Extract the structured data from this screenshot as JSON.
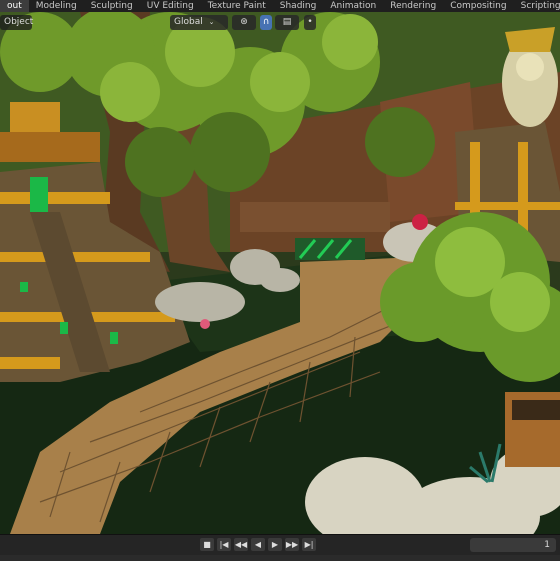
{
  "workspace_tabs": [
    {
      "label": "out",
      "active": true
    },
    {
      "label": "Modeling",
      "active": false
    },
    {
      "label": "Sculpting",
      "active": false
    },
    {
      "label": "UV Editing",
      "active": false
    },
    {
      "label": "Texture Paint",
      "active": false
    },
    {
      "label": "Shading",
      "active": false
    },
    {
      "label": "Animation",
      "active": false
    },
    {
      "label": "Rendering",
      "active": false
    },
    {
      "label": "Compositing",
      "active": false
    },
    {
      "label": "Scripting",
      "active": false
    }
  ],
  "add_tab_label": "+",
  "viewport_header": {
    "mode_label": "Object",
    "transform_orientation": "Global",
    "pivot_icon": "pivot-icon",
    "snap_icon": "magnet-icon",
    "proportional_icon": "proportional-icon"
  },
  "timeline": {
    "current_frame": "1",
    "controls": [
      "■",
      "|◀",
      "◀◀",
      "◀",
      "▶",
      "▶▶",
      "▶|"
    ]
  },
  "colors": {
    "active_tab": "#3d3d3d",
    "accent_blue": "#4772b3",
    "ui_bg": "#1f1f1f"
  }
}
